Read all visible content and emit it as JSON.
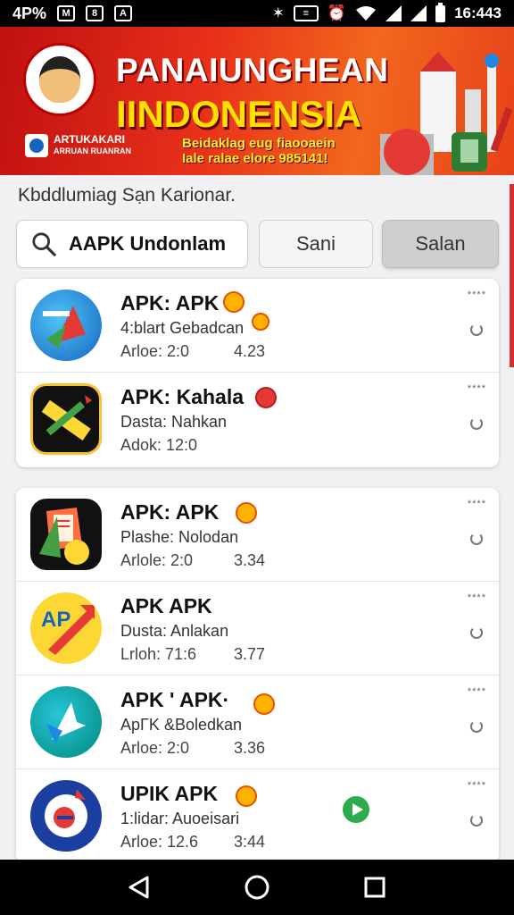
{
  "status_bar": {
    "left_text": "4P%",
    "box_icons": [
      "M",
      "8",
      "A"
    ],
    "time": "16:443",
    "icons": [
      "bluetooth-icon",
      "vibrate-icon",
      "alarm-icon",
      "wifi-icon",
      "signal-icon",
      "signal-icon",
      "battery-icon"
    ]
  },
  "banner": {
    "title": "PANAIUNGHEAN",
    "subtitle": "IINDONENSIA",
    "tagline_1": "Beidaklag eug fiaooaein",
    "tagline_2": "Iale ralae elore 985141!",
    "org_name_1": "ARTUKAKARI",
    "org_name_2": "ARRUAN RUANRAN",
    "colors": {
      "primary": "#e8301a",
      "title": "#ffffff",
      "subtitle": "#ffe000"
    }
  },
  "header": {
    "hint": "Kbddlumiag Sạn Karionar."
  },
  "search": {
    "value": "AAPK Undonlam",
    "icon": "search-icon"
  },
  "buttons": {
    "sani": "Sani",
    "salan": "Salan"
  },
  "cards": [
    {
      "apps": [
        {
          "name": "APK: APK",
          "sub": "4:blart Gebadcan",
          "meta": "Arloe: 2:0",
          "rating": "4.23",
          "stars": "****",
          "icon": "maps-arrow-icon"
        },
        {
          "name": "APK: Kahala",
          "sub": "Dasta: Nahkan",
          "meta": "Adok: 12:0",
          "rating": "",
          "stars": "****",
          "icon": "pencil-ruler-icon"
        }
      ]
    },
    {
      "apps": [
        {
          "name": "APK: APK",
          "sub": "Plashe: Nolodan",
          "meta": "Arlole: 2:0",
          "rating": "3.34",
          "stars": "****",
          "icon": "document-emoji-icon"
        },
        {
          "name": "APK APK",
          "sub": "Dusta: Anlakan",
          "meta": "Lrloh: 71:6",
          "rating": "3.77",
          "stars": "****",
          "icon": "ap-arrow-icon"
        },
        {
          "name": "APK ' APK·",
          "sub": "ApΓK &Boledkan",
          "meta": "Arloe: 2:0",
          "rating": "3.36",
          "stars": "****",
          "icon": "green-arrow-icon"
        },
        {
          "name": "UPIK APK",
          "sub": "1:lidar: Auoeisari",
          "meta": "Arloe: 12.6",
          "rating": "3:44",
          "stars": "****",
          "icon": "blue-emblem-icon"
        }
      ]
    }
  ],
  "nav": {
    "icons": [
      "back-icon",
      "home-icon",
      "recents-icon"
    ]
  }
}
